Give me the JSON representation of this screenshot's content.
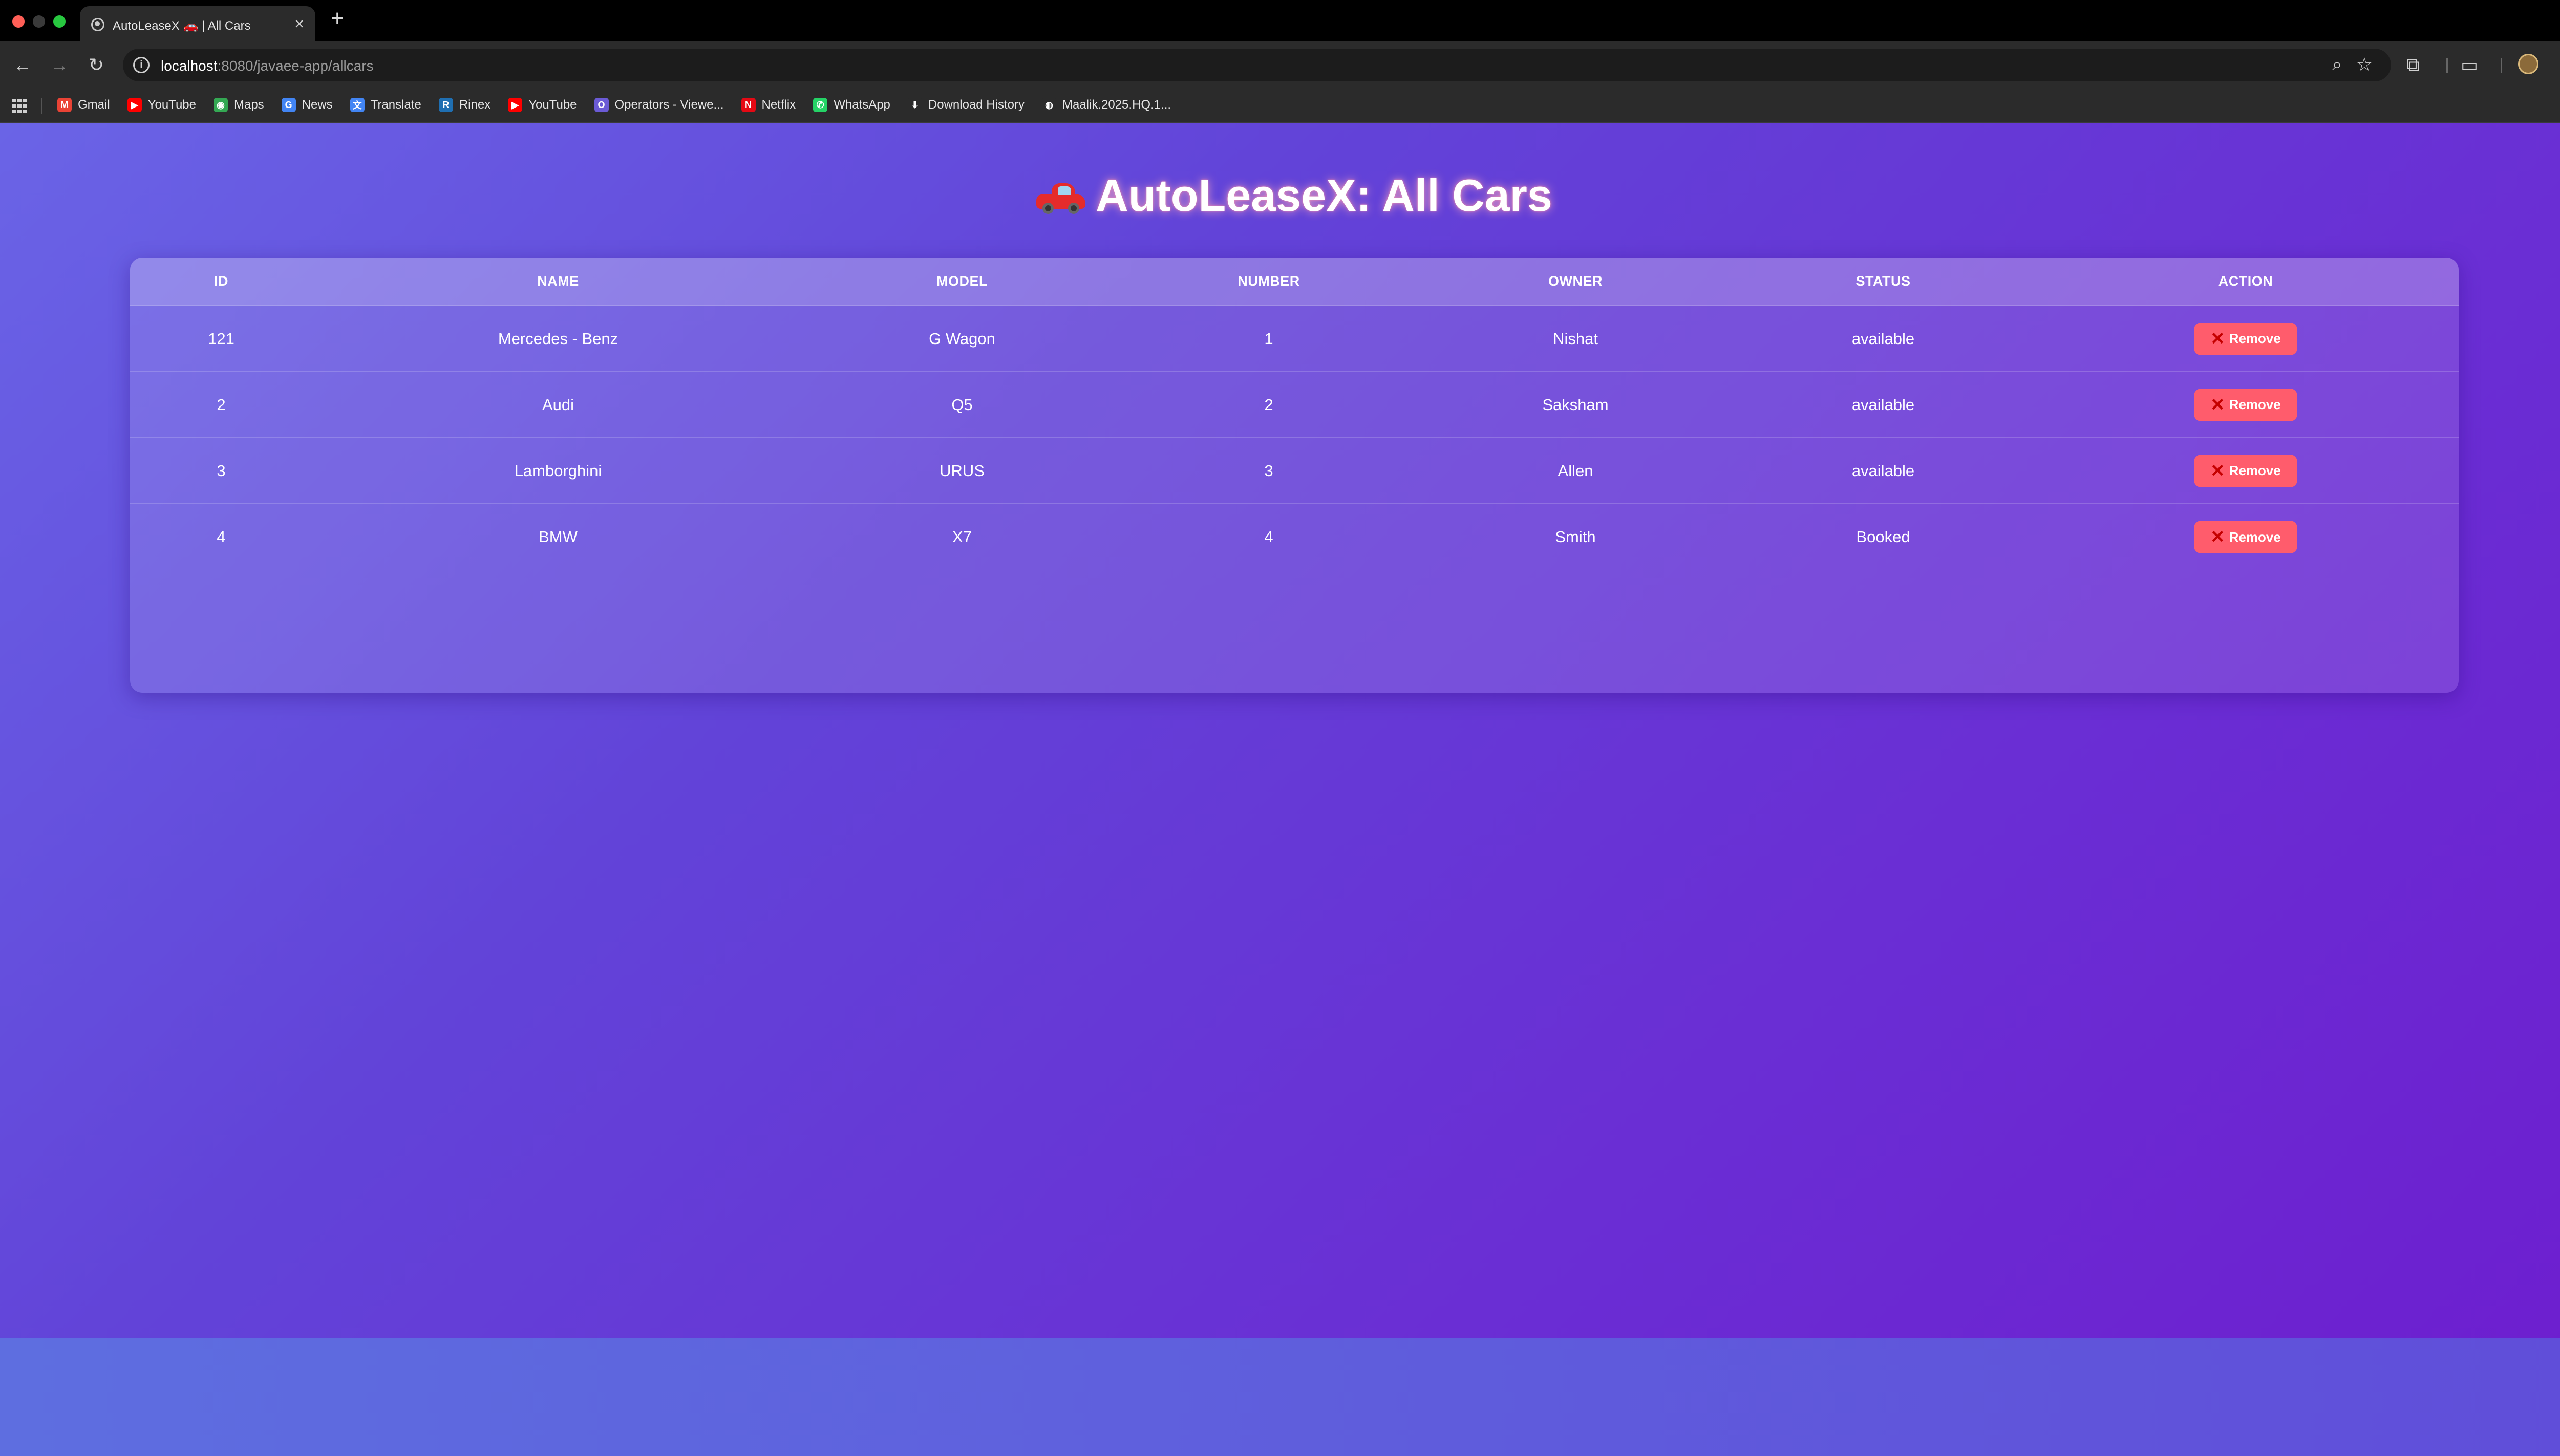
{
  "browser": {
    "tab_title": "AutoLeaseX 🚗 | All Cars",
    "tab_close": "×",
    "new_tab": "+",
    "url_host": "localhost",
    "url_rest": ":8080/javaee-app/allcars"
  },
  "bookmarks": [
    {
      "label": "Gmail",
      "icon": "gmail-icon",
      "color": "#ea4335",
      "glyph": "M"
    },
    {
      "label": "YouTube",
      "icon": "youtube-icon",
      "color": "#ff0000",
      "glyph": "▶"
    },
    {
      "label": "Maps",
      "icon": "maps-icon",
      "color": "#34a853",
      "glyph": "◉"
    },
    {
      "label": "News",
      "icon": "news-icon",
      "color": "#4285f4",
      "glyph": "G"
    },
    {
      "label": "Translate",
      "icon": "translate-icon",
      "color": "#4285f4",
      "glyph": "文"
    },
    {
      "label": "Rinex",
      "icon": "rinex-icon",
      "color": "#1f6fb2",
      "glyph": "R"
    },
    {
      "label": "YouTube",
      "icon": "youtube-icon",
      "color": "#ff0000",
      "glyph": "▶"
    },
    {
      "label": "Operators - Viewe...",
      "icon": "operators-icon",
      "color": "#6b5bd6",
      "glyph": "O"
    },
    {
      "label": "Netflix",
      "icon": "netflix-icon",
      "color": "#e50914",
      "glyph": "N"
    },
    {
      "label": "WhatsApp",
      "icon": "whatsapp-icon",
      "color": "#25d366",
      "glyph": "✆"
    },
    {
      "label": "Download History",
      "icon": "download-icon",
      "color": "#2b2b2b",
      "glyph": "⬇"
    },
    {
      "label": "Maalik.2025.HQ.1...",
      "icon": "globe-icon",
      "color": "#2b2b2b",
      "glyph": "◍"
    }
  ],
  "page": {
    "title": "AutoLeaseX: All Cars",
    "columns": [
      "ID",
      "NAME",
      "MODEL",
      "NUMBER",
      "OWNER",
      "STATUS",
      "ACTION"
    ],
    "rows": [
      {
        "id": "121",
        "name": "Mercedes - Benz",
        "model": "G Wagon",
        "number": "1",
        "owner": "Nishat",
        "status": "available",
        "action": "Remove"
      },
      {
        "id": "2",
        "name": "Audi",
        "model": "Q5",
        "number": "2",
        "owner": "Saksham",
        "status": "available",
        "action": "Remove"
      },
      {
        "id": "3",
        "name": "Lamborghini",
        "model": "URUS",
        "number": "3",
        "owner": "Allen",
        "status": "available",
        "action": "Remove"
      },
      {
        "id": "4",
        "name": "BMW",
        "model": "X7",
        "number": "4",
        "owner": "Smith",
        "status": "Booked",
        "action": "Remove"
      }
    ],
    "remove_glyph": "✕"
  },
  "colors": {
    "gradient_start": "#6a64e6",
    "gradient_end": "#6d1fcf",
    "remove_button": "#ff5c6c",
    "title_glow": "#ffaabe"
  }
}
